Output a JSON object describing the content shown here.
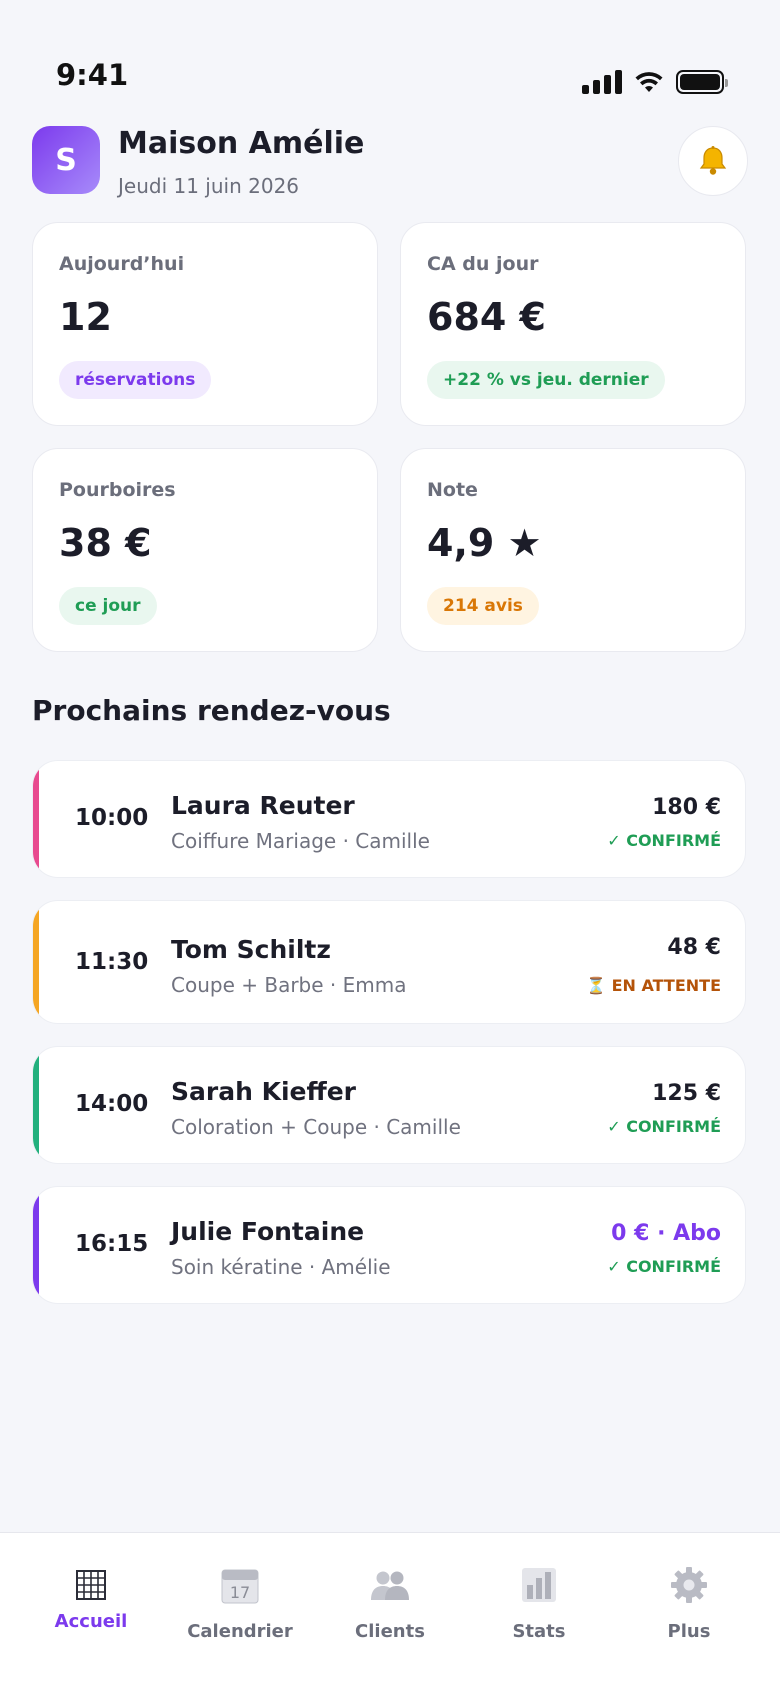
{
  "status_bar": {
    "time": "9:41"
  },
  "header": {
    "logo_letter": "S",
    "salon_name": "Maison Amélie",
    "date": "Jeudi 11 juin 2026"
  },
  "stats": [
    {
      "label": "Aujourd’hui",
      "value": "12",
      "badge": "réservations"
    },
    {
      "label": "CA du jour",
      "value": "684 €",
      "badge": "+22 % vs jeu. dernier"
    },
    {
      "label": "Pourboires",
      "value": "38 €",
      "badge": "ce jour"
    },
    {
      "label": "Note",
      "value": "4,9 ★",
      "badge": "214 avis"
    }
  ],
  "section_title": "Prochains rendez-vous",
  "appointments": [
    {
      "time": "10:00",
      "client": "Laura Reuter",
      "service": "Coiffure Mariage · Camille",
      "price": "180 €",
      "status": "✓ CONFIRMÉ",
      "color": "#e84a8f"
    },
    {
      "time": "11:30",
      "client": "Tom Schiltz",
      "service": "Coupe + Barbe · Emma",
      "price": "48 €",
      "status": "⏳ EN ATTENTE",
      "color": "#f5a623"
    },
    {
      "time": "14:00",
      "client": "Sarah Kieffer",
      "service": "Coloration + Coupe · Camille",
      "price": "125 €",
      "status": "✓ CONFIRMÉ",
      "color": "#22b07d"
    },
    {
      "time": "16:15",
      "client": "Julie Fontaine",
      "service": "Soin kératine · Amélie",
      "price": "0 € · Abo",
      "status": "✓ CONFIRMÉ",
      "color": "#7c3aed"
    }
  ],
  "tabs": [
    {
      "label": "Accueil",
      "icon": "grid-icon"
    },
    {
      "label": "Calendrier",
      "icon": "calendar-icon"
    },
    {
      "label": "Clients",
      "icon": "users-icon"
    },
    {
      "label": "Stats",
      "icon": "bar-chart-icon"
    },
    {
      "label": "Plus",
      "icon": "gear-icon"
    }
  ],
  "colors": {
    "accent": "#7c3aed",
    "confirmed": "#1f9d55",
    "pending": "#b45309"
  }
}
